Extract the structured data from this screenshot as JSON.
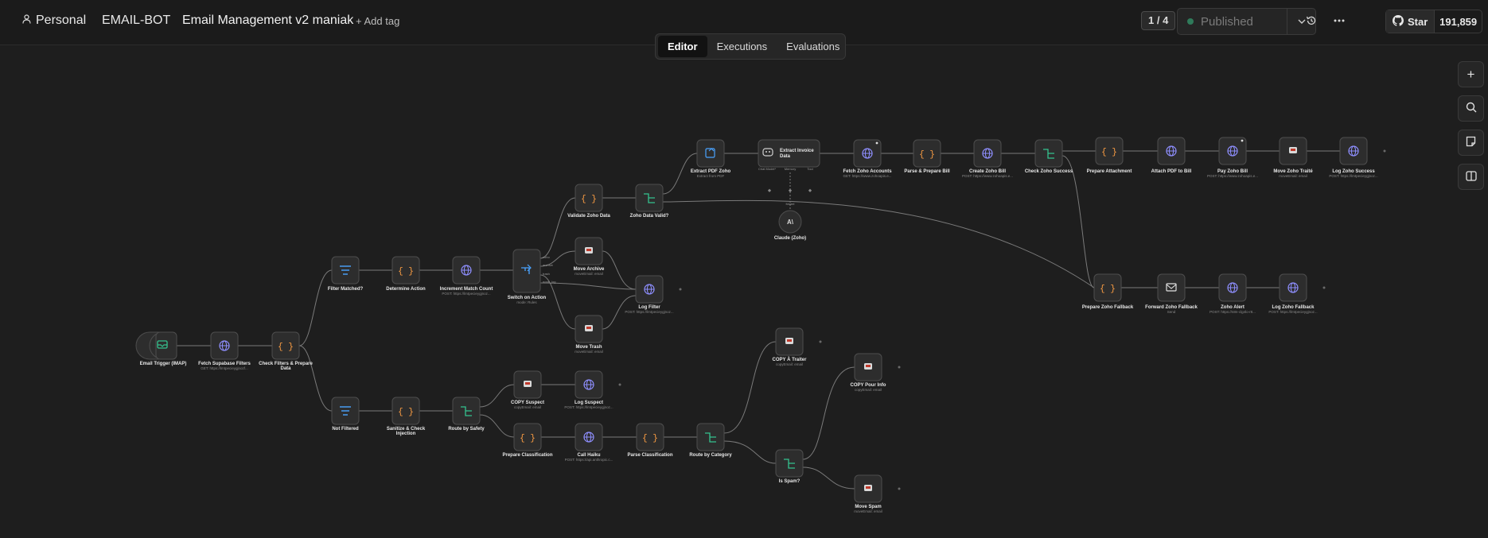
{
  "header": {
    "project": "Personal",
    "folder": "EMAIL-BOT",
    "workflow_name": "Email Management v2 maniak",
    "add_tag": "+ Add tag",
    "version": "1 / 4",
    "publish_label": "Published",
    "github_star": "Star",
    "github_count": "191,859"
  },
  "tabs": [
    "Editor",
    "Executions",
    "Evaluations"
  ],
  "active_tab": "Editor",
  "sidebar_buttons": [
    "add-node",
    "search",
    "sticky-note",
    "toggle-panel"
  ],
  "nodes": {
    "email_trigger": {
      "label": "Email Trigger (IMAP)",
      "sub": ""
    },
    "fetch_supabase": {
      "label": "Fetch Supabase Filters",
      "sub": "GET: https://lmtpecieygjnozf..."
    },
    "check_filters": {
      "label": "Check Filters & Prepare",
      "label2": "Data",
      "sub": ""
    },
    "filter_matched": {
      "label": "Filter Matched?",
      "sub": ""
    },
    "determine_action": {
      "label": "Determine Action",
      "sub": ""
    },
    "increment_match": {
      "label": "Increment Match Count",
      "sub": "POST: https://lmtpecieygjnoz..."
    },
    "switch_action": {
      "label": "Switch on Action",
      "sub": "mode: Rules"
    },
    "validate_zoho": {
      "label": "Validate Zoho Data",
      "sub": ""
    },
    "zoho_valid": {
      "label": "Zoho Data Valid?",
      "sub": ""
    },
    "move_archive": {
      "label": "Move Archive",
      "sub": "moveEmail: email"
    },
    "log_filter": {
      "label": "Log Filter",
      "sub": "POST: https://lmtpecieygjnoz..."
    },
    "move_trash": {
      "label": "Move Trash",
      "sub": "moveEmail: email"
    },
    "extract_pdf": {
      "label": "Extract PDF Zoho",
      "sub": "Extract from PDF"
    },
    "extract_invoice": {
      "label": "Extract Invoice",
      "label2": "Data",
      "sub": ""
    },
    "claude_zoho": {
      "label": "Claude (Zoho)",
      "sub": ""
    },
    "fetch_zoho_accounts": {
      "label": "Fetch Zoho Accounts",
      "sub": "GET: https://www.zohoapis.e..."
    },
    "parse_prepare_bill": {
      "label": "Parse & Prepare Bill",
      "sub": ""
    },
    "create_zoho_bill": {
      "label": "Create Zoho Bill",
      "sub": "POST: https://www.zohoapis.e..."
    },
    "check_zoho_success": {
      "label": "Check Zoho Success",
      "sub": ""
    },
    "prepare_attachment": {
      "label": "Prepare Attachment",
      "sub": ""
    },
    "attach_pdf": {
      "label": "Attach PDF to Bill",
      "sub": ""
    },
    "pay_zoho_bill": {
      "label": "Pay Zoho Bill",
      "sub": "POST: https://www.zohoapis.e..."
    },
    "move_zoho_traite": {
      "label": "Move Zoho Traité",
      "sub": "moveEmail: email"
    },
    "log_zoho_success": {
      "label": "Log Zoho Success",
      "sub": "POST: https://lmtpecieygjnoz..."
    },
    "prepare_zoho_fallback": {
      "label": "Prepare Zoho Fallback",
      "sub": ""
    },
    "forward_zoho_fallback": {
      "label": "Forward Zoho Fallback",
      "sub": "Send"
    },
    "zoho_alert": {
      "label": "Zoho Alert",
      "sub": "POST: https://n8n-clg4lo-r8..."
    },
    "log_zoho_fallback": {
      "label": "Log Zoho Fallback",
      "sub": "POST: https://lmtpecieygjnoz..."
    },
    "not_filtered": {
      "label": "Not Filtered",
      "sub": ""
    },
    "sanitize_check": {
      "label": "Sanitize & Check",
      "label2": "Injection",
      "sub": ""
    },
    "route_safety": {
      "label": "Route by Safety",
      "sub": ""
    },
    "copy_suspect": {
      "label": "COPY Suspect",
      "sub": "copyEmail: email"
    },
    "log_suspect": {
      "label": "Log Suspect",
      "sub": "POST: https://lmtpecieygjnoz..."
    },
    "prepare_classification": {
      "label": "Prepare Classification",
      "sub": ""
    },
    "call_haiku": {
      "label": "Call Haiku",
      "sub": "POST: https://api.anthropic.c..."
    },
    "parse_classification": {
      "label": "Parse Classification",
      "sub": ""
    },
    "route_category": {
      "label": "Route by Category",
      "sub": ""
    },
    "copy_traiter": {
      "label": "COPY À Traiter",
      "sub": "copyEmail: email"
    },
    "copy_pour_info": {
      "label": "COPY Pour Info",
      "sub": "copyEmail: email"
    },
    "is_spam": {
      "label": "Is Spam?",
      "sub": ""
    },
    "move_spam": {
      "label": "Move Spam",
      "sub": "moveEmail: email"
    }
  },
  "handle_labels": {
    "chat_model": "Chat Model*",
    "memory": "Memory",
    "tool": "Tool",
    "model": "Model",
    "switch_outputs": [
      "zoho",
      "archive",
      "trash",
      "none_log"
    ]
  }
}
